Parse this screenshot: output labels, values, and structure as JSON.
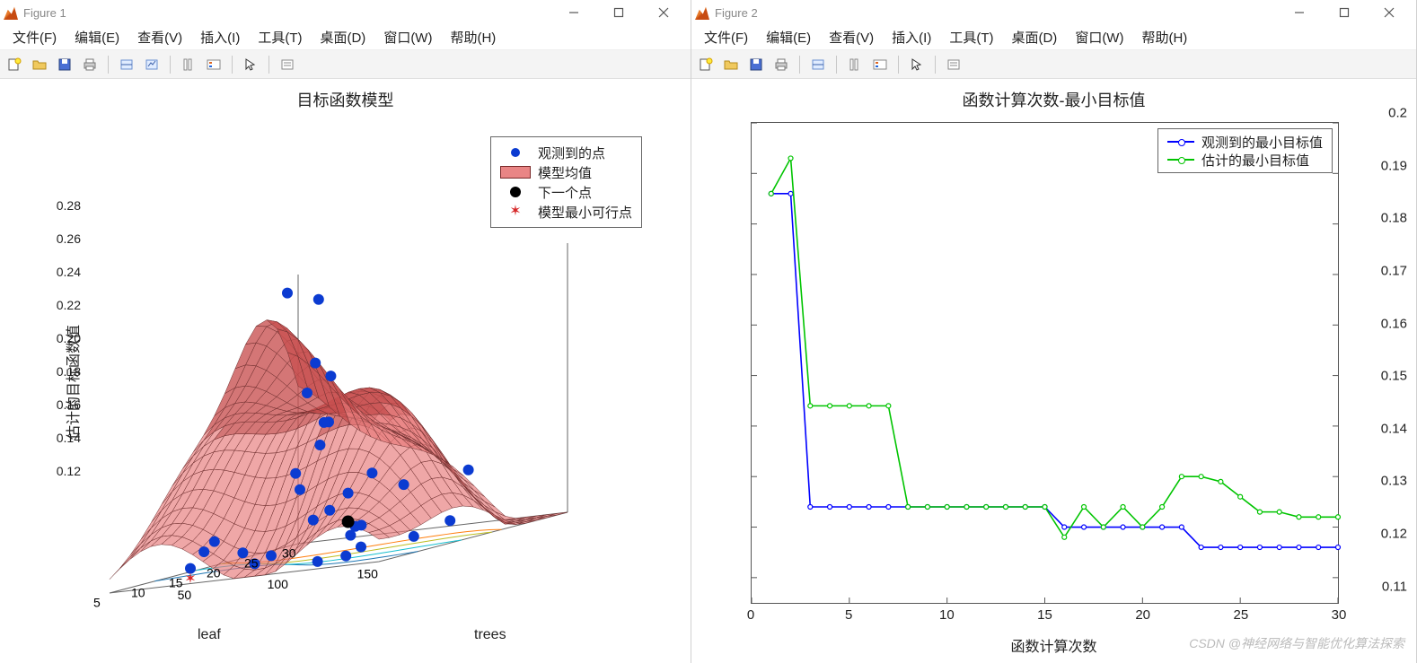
{
  "windows": [
    {
      "title": "Figure 1"
    },
    {
      "title": "Figure 2"
    }
  ],
  "menus": {
    "file": "文件(F)",
    "edit": "编辑(E)",
    "view": "查看(V)",
    "insert": "插入(I)",
    "tools": "工具(T)",
    "desktop": "桌面(D)",
    "window": "窗口(W)",
    "help": "帮助(H)"
  },
  "toolbar_icons": [
    "new-figure",
    "open",
    "save",
    "print",
    "datacursor",
    "link",
    "colorbar",
    "legend",
    "pointer",
    "edit-plot"
  ],
  "chart_data": [
    {
      "type": "surface",
      "title": "目标函数模型",
      "zlabel": "估计的目标函数值",
      "xlabel": "leaf",
      "ylabel": "trees",
      "x_ticks": [
        30,
        25,
        20,
        15,
        10,
        5
      ],
      "y_ticks": [
        50,
        100,
        150
      ],
      "z_ticks": [
        0.12,
        0.14,
        0.16,
        0.18,
        0.2,
        0.22,
        0.24,
        0.26,
        0.28
      ],
      "x_range": [
        5,
        30
      ],
      "y_range": [
        10,
        160
      ],
      "z_range": [
        0.12,
        0.28
      ],
      "legend": [
        {
          "marker": "blue-dot",
          "label": "观测到的点"
        },
        {
          "marker": "red-patch",
          "label": "模型均值"
        },
        {
          "marker": "black-dot",
          "label": "下一个点"
        },
        {
          "marker": "red-star",
          "label": "模型最小可行点"
        }
      ],
      "observed_points": [
        {
          "leaf": 30,
          "trees": 15,
          "z": 0.209
        },
        {
          "leaf": 25,
          "trees": 25,
          "z": 0.273
        },
        {
          "leaf": 22,
          "trees": 55,
          "z": 0.269
        },
        {
          "leaf": 26,
          "trees": 45,
          "z": 0.22
        },
        {
          "leaf": 18,
          "trees": 70,
          "z": 0.234
        },
        {
          "leaf": 15,
          "trees": 90,
          "z": 0.2
        },
        {
          "leaf": 21,
          "trees": 60,
          "z": 0.183
        },
        {
          "leaf": 12,
          "trees": 100,
          "z": 0.202
        },
        {
          "leaf": 16,
          "trees": 110,
          "z": 0.166
        },
        {
          "leaf": 19,
          "trees": 115,
          "z": 0.155
        },
        {
          "leaf": 10,
          "trees": 95,
          "z": 0.165
        },
        {
          "leaf": 14,
          "trees": 105,
          "z": 0.157
        },
        {
          "leaf": 13,
          "trees": 80,
          "z": 0.173
        },
        {
          "leaf": 8,
          "trees": 120,
          "z": 0.152
        },
        {
          "leaf": 9,
          "trees": 130,
          "z": 0.14
        },
        {
          "leaf": 11,
          "trees": 125,
          "z": 0.139
        },
        {
          "leaf": 7,
          "trees": 115,
          "z": 0.148
        },
        {
          "leaf": 6,
          "trees": 140,
          "z": 0.137
        },
        {
          "leaf": 5,
          "trees": 150,
          "z": 0.13
        },
        {
          "leaf": 5,
          "trees": 100,
          "z": 0.131
        },
        {
          "leaf": 6,
          "trees": 80,
          "z": 0.134
        },
        {
          "leaf": 7,
          "trees": 60,
          "z": 0.142
        },
        {
          "leaf": 8,
          "trees": 50,
          "z": 0.136
        },
        {
          "leaf": 5,
          "trees": 55,
          "z": 0.129
        },
        {
          "leaf": 4,
          "trees": 130,
          "z": 0.125
        },
        {
          "leaf": 4,
          "trees": 95,
          "z": 0.128
        },
        {
          "leaf": 3,
          "trees": 150,
          "z": 0.127
        },
        {
          "leaf": 12,
          "trees": 150,
          "z": 0.128
        },
        {
          "leaf": 18,
          "trees": 145,
          "z": 0.131
        },
        {
          "leaf": 24,
          "trees": 130,
          "z": 0.156
        }
      ],
      "next_point": {
        "leaf": 14,
        "trees": 105,
        "z": 0.14
      },
      "min_feasible": {
        "leaf": 5,
        "trees": 55,
        "z": 0.123
      }
    },
    {
      "type": "line",
      "title": "函数计算次数-最小目标值",
      "xlabel": "函数计算次数",
      "ylabel": "",
      "x_ticks": [
        0,
        5,
        10,
        15,
        20,
        25,
        30
      ],
      "y_ticks": [
        0.11,
        0.12,
        0.13,
        0.14,
        0.15,
        0.16,
        0.17,
        0.18,
        0.19,
        0.2
      ],
      "xlim": [
        0,
        30
      ],
      "ylim": [
        0.105,
        0.2
      ],
      "series": [
        {
          "name": "观测到的最小目标值",
          "color": "#0000ff",
          "x": [
            1,
            2,
            3,
            4,
            5,
            6,
            7,
            8,
            9,
            10,
            11,
            12,
            13,
            14,
            15,
            16,
            17,
            18,
            19,
            20,
            21,
            22,
            23,
            24,
            25,
            26,
            27,
            28,
            29,
            30
          ],
          "y": [
            0.186,
            0.186,
            0.124,
            0.124,
            0.124,
            0.124,
            0.124,
            0.124,
            0.124,
            0.124,
            0.124,
            0.124,
            0.124,
            0.124,
            0.124,
            0.12,
            0.12,
            0.12,
            0.12,
            0.12,
            0.12,
            0.12,
            0.116,
            0.116,
            0.116,
            0.116,
            0.116,
            0.116,
            0.116,
            0.116
          ]
        },
        {
          "name": "估计的最小目标值",
          "color": "#00c400",
          "x": [
            1,
            2,
            3,
            4,
            5,
            6,
            7,
            8,
            9,
            10,
            11,
            12,
            13,
            14,
            15,
            16,
            17,
            18,
            19,
            20,
            21,
            22,
            23,
            24,
            25,
            26,
            27,
            28,
            29,
            30
          ],
          "y": [
            0.186,
            0.193,
            0.144,
            0.144,
            0.144,
            0.144,
            0.144,
            0.124,
            0.124,
            0.124,
            0.124,
            0.124,
            0.124,
            0.124,
            0.124,
            0.118,
            0.124,
            0.12,
            0.124,
            0.12,
            0.124,
            0.13,
            0.13,
            0.129,
            0.126,
            0.123,
            0.123,
            0.122,
            0.122,
            0.122
          ]
        }
      ]
    }
  ],
  "watermark": "CSDN @神经网络与智能优化算法探索"
}
